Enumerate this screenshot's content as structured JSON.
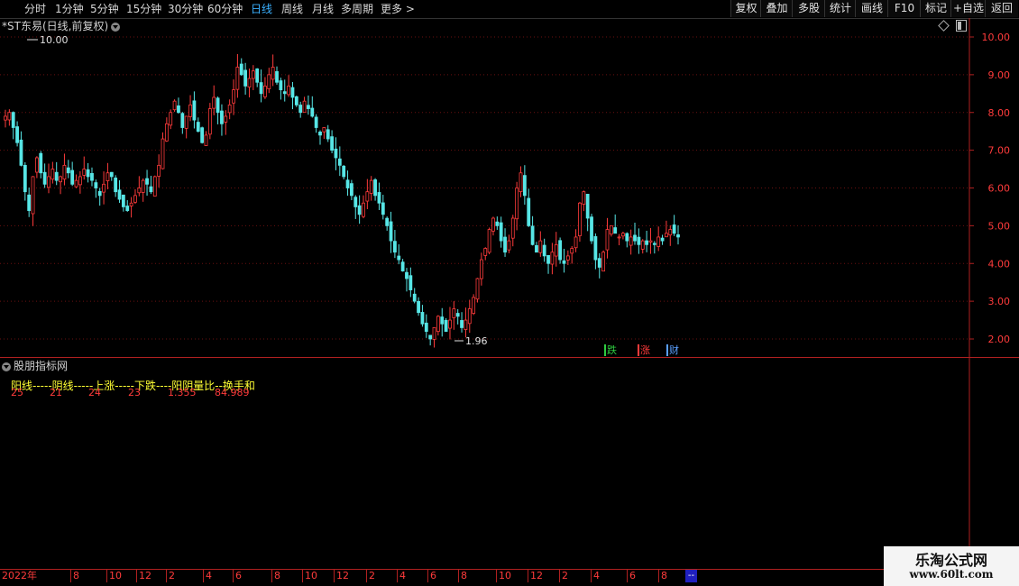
{
  "topbar": {
    "periods": [
      "分时",
      "1分钟",
      "5分钟",
      "15分钟",
      "30分钟",
      "60分钟",
      "日线",
      "周线",
      "月线",
      "多周期",
      "更多 >"
    ],
    "active_period": "日线",
    "tools": [
      "复权",
      "叠加",
      "多股",
      "统计",
      "画线",
      "F10",
      "标记",
      "+自选",
      "返回"
    ]
  },
  "chart": {
    "title": "*ST东易(日线,前复权)",
    "y_ticks": [
      "10.00",
      "9.00",
      "8.00",
      "7.00",
      "6.00",
      "5.00",
      "4.00",
      "3.00",
      "2.00"
    ],
    "high_label": "10.00",
    "low_label": "1.96",
    "markers": [
      {
        "text": "跌",
        "color": "#2ecc40"
      },
      {
        "text": "涨",
        "color": "#ff3b3b"
      },
      {
        "text": "财",
        "color": "#5aa0ff"
      }
    ],
    "up_color": "#ff3b3b",
    "down_color": "#57e6e6"
  },
  "indicator": {
    "title": "股朋指标网",
    "labels": "阳线-----阴线-----上涨-----下跌----阳阴量比--换手和",
    "values": [
      "25",
      "21",
      "24",
      "23",
      "1.355",
      "84.989"
    ]
  },
  "timeline": {
    "labels": [
      "2022年",
      "8",
      "10",
      "12",
      "2",
      "4",
      "6",
      "8",
      "10",
      "12",
      "2",
      "4",
      "6",
      "8",
      "10",
      "12",
      "2",
      "4",
      "6",
      "8"
    ],
    "cursor": "--"
  },
  "watermark": {
    "line1": "乐淘公式网",
    "line2": "www.60lt.com"
  },
  "chart_data": {
    "type": "candlestick",
    "y_range": [
      2.0,
      10.0
    ],
    "x_start": "2022年",
    "close_trace": [
      7.9,
      8.0,
      7.6,
      7.2,
      6.6,
      5.9,
      5.4,
      6.3,
      6.8,
      6.4,
      6.1,
      6.3,
      6.5,
      6.2,
      6.3,
      6.6,
      6.4,
      6.1,
      6.2,
      6.3,
      6.5,
      6.3,
      6.2,
      6.0,
      5.8,
      6.1,
      6.4,
      6.3,
      5.9,
      5.7,
      5.5,
      5.4,
      5.6,
      5.8,
      6.0,
      6.2,
      6.1,
      5.9,
      6.3,
      6.6,
      7.3,
      7.7,
      8.0,
      8.3,
      8.0,
      7.6,
      7.9,
      8.2,
      7.8,
      7.5,
      7.2,
      7.4,
      8.1,
      8.4,
      8.0,
      7.7,
      7.9,
      8.2,
      8.6,
      9.2,
      9.0,
      8.7,
      8.9,
      9.1,
      8.8,
      8.5,
      8.7,
      9.0,
      9.2,
      8.8,
      8.6,
      8.5,
      8.7,
      8.4,
      8.2,
      8.0,
      8.3,
      8.1,
      7.9,
      7.6,
      7.4,
      7.6,
      7.3,
      7.0,
      6.8,
      6.6,
      6.3,
      6.0,
      5.8,
      5.5,
      5.3,
      5.6,
      5.9,
      6.2,
      5.8,
      5.6,
      5.3,
      5.0,
      4.6,
      4.3,
      4.1,
      3.8,
      3.6,
      3.3,
      3.0,
      2.7,
      2.4,
      2.2,
      2.0,
      2.3,
      2.6,
      2.4,
      2.2,
      2.5,
      2.8,
      2.6,
      2.3,
      2.5,
      2.8,
      3.1,
      3.6,
      4.1,
      4.4,
      4.9,
      5.2,
      5.0,
      4.6,
      4.3,
      4.6,
      5.2,
      6.0,
      6.4,
      5.8,
      5.0,
      4.5,
      4.3,
      4.6,
      4.2,
      4.0,
      4.3,
      4.5,
      4.1,
      4.0,
      4.2,
      4.4,
      4.7,
      5.6,
      5.9,
      5.2,
      4.6,
      4.1,
      3.9,
      4.3,
      4.9,
      5.0,
      4.8,
      4.7,
      4.8,
      4.6,
      4.7,
      4.6,
      4.5,
      4.6,
      4.5,
      4.6,
      4.5,
      4.7,
      4.6,
      4.8,
      4.9,
      4.8,
      4.7
    ]
  }
}
